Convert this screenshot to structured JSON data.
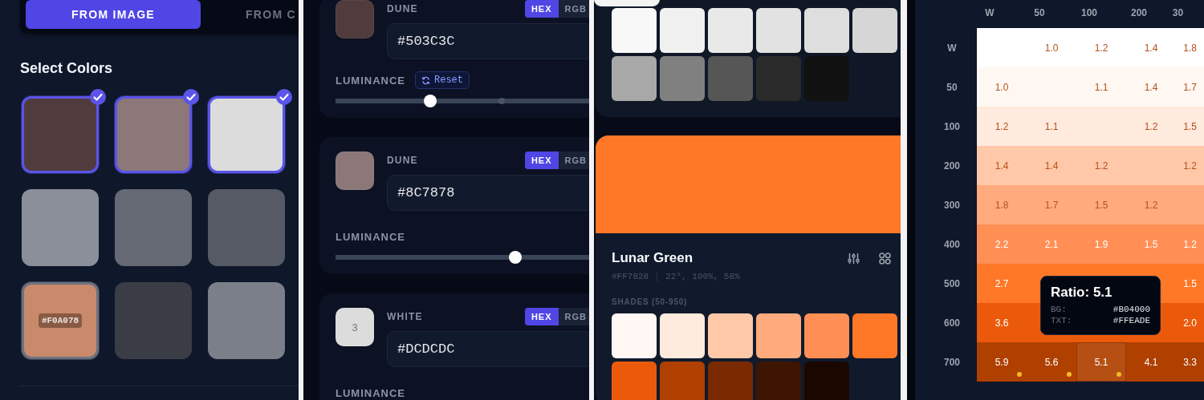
{
  "palette_picker": {
    "tabs": [
      {
        "label": "FROM IMAGE",
        "selected": true
      },
      {
        "label": "FROM C",
        "selected": false
      }
    ],
    "heading": "Select Colors",
    "swatches": [
      {
        "color": "#503c3c",
        "selected": true,
        "hovered": false
      },
      {
        "color": "#8c7878",
        "selected": true,
        "hovered": false
      },
      {
        "color": "#dcdcdc",
        "selected": true,
        "hovered": false
      },
      {
        "color": "#8a8f99",
        "selected": false,
        "hovered": false
      },
      {
        "color": "#646973",
        "selected": false,
        "hovered": false
      },
      {
        "color": "#555a64",
        "selected": false,
        "hovered": false
      },
      {
        "color": "#c98a6b",
        "selected": false,
        "hovered": true,
        "label": "#F0A078"
      },
      {
        "color": "#3a3d46",
        "selected": false,
        "hovered": false
      },
      {
        "color": "#7b7f89",
        "selected": false,
        "hovered": false
      }
    ]
  },
  "color_editors": [
    {
      "name": "DUNE",
      "color": "#503c3c",
      "formats": [
        {
          "label": "HEX",
          "selected": true
        },
        {
          "label": "RGB",
          "selected": false
        }
      ],
      "value": "#503C3C",
      "luminance": {
        "label": "LUMINANCE",
        "reset": "Reset",
        "level": 0.31,
        "original": {
          "level": 0.545
        }
      }
    },
    {
      "name": "DUNE",
      "color": "#8c7878",
      "formats": [
        {
          "label": "HEX",
          "selected": true
        },
        {
          "label": "RGB",
          "selected": false
        }
      ],
      "value": "#8C7878",
      "luminance": {
        "label": "LUMINANCE",
        "level": 0.59
      }
    },
    {
      "name": "WHITE",
      "color": "#dcdcdc",
      "swatch_label": "3",
      "formats": [
        {
          "label": "HEX",
          "selected": true
        },
        {
          "label": "RGB",
          "selected": false
        }
      ],
      "value": "#DCDCDC",
      "luminance": {
        "label": "LUMINANCE"
      }
    }
  ],
  "palette_preview": {
    "neutral_shades": [
      {
        "color": "#f8f8f8"
      },
      {
        "color": "#f0f0f0"
      },
      {
        "color": "#e9e9e9"
      },
      {
        "color": "#e2e2e2"
      },
      {
        "color": "#dedede"
      },
      {
        "color": "#d6d6d6"
      },
      {
        "color": "#a8a8a8"
      },
      {
        "color": "#808080"
      },
      {
        "color": "#565656"
      },
      {
        "color": "#2a2a2a"
      },
      {
        "color": "#111111"
      }
    ],
    "palette": {
      "color": "#ff7828",
      "name": "Lunar Green",
      "hex": "#FF7828",
      "hsl": "22°, 100%, 58%",
      "shades_label": "SHADES (50-950)",
      "shades": [
        {
          "color": "#fff8f4"
        },
        {
          "color": "#ffeade"
        },
        {
          "color": "#ffc9a8"
        },
        {
          "color": "#ffab7e"
        },
        {
          "color": "#ff8f55"
        },
        {
          "color": "#ff7828"
        },
        {
          "color": "#eb5a0a"
        },
        {
          "color": "#b04000"
        },
        {
          "color": "#7a2a00"
        },
        {
          "color": "#3d1500"
        },
        {
          "color": "#1a0800"
        }
      ]
    }
  },
  "contrast_grid": {
    "columns": [
      "W",
      "50",
      "100",
      "200",
      "30"
    ],
    "rows": [
      {
        "label": "W",
        "color": "#ffffff",
        "cells": [
          {},
          {
            "value": "1.0"
          },
          {
            "value": "1.2"
          },
          {
            "value": "1.4"
          },
          {
            "value": "1.8"
          }
        ]
      },
      {
        "label": "50",
        "color": "#fff7f2",
        "cells": [
          {
            "value": "1.0"
          },
          {},
          {
            "value": "1.1"
          },
          {
            "value": "1.4"
          },
          {
            "value": "1.7"
          }
        ]
      },
      {
        "label": "100",
        "color": "#ffeade",
        "cells": [
          {
            "value": "1.2"
          },
          {
            "value": "1.1"
          },
          {},
          {
            "value": "1.2"
          },
          {
            "value": "1.5"
          }
        ]
      },
      {
        "label": "200",
        "color": "#ffc8a8",
        "cells": [
          {
            "value": "1.4"
          },
          {
            "value": "1.4"
          },
          {
            "value": "1.2"
          },
          {},
          {
            "value": "1.2"
          }
        ]
      },
      {
        "label": "300",
        "color": "#ffab7e",
        "cells": [
          {
            "value": "1.8"
          },
          {
            "value": "1.7"
          },
          {
            "value": "1.5"
          },
          {
            "value": "1.2"
          },
          {}
        ]
      },
      {
        "label": "400",
        "color": "#ff8f55",
        "cells": [
          {
            "value": "2.2"
          },
          {
            "value": "2.1"
          },
          {
            "value": "1.9"
          },
          {
            "value": "1.5"
          },
          {
            "value": "1.2"
          }
        ]
      },
      {
        "label": "500",
        "color": "#ff7828",
        "cells": [
          {
            "value": "2.7"
          },
          {},
          {},
          {},
          {
            "value": "1.5"
          }
        ]
      },
      {
        "label": "600",
        "color": "#eb5a0a",
        "cells": [
          {
            "value": "3.6"
          },
          {},
          {},
          {},
          {
            "value": "2.0"
          }
        ]
      },
      {
        "label": "700",
        "color": "#b04000",
        "cells": [
          {
            "value": "5.9",
            "dot": true,
            "selected": false
          },
          {
            "value": "5.6",
            "dot": true,
            "selected": false
          },
          {
            "value": "5.1",
            "dot": true,
            "selected": true
          },
          {
            "value": "4.1",
            "dot": false,
            "selected": false
          },
          {
            "value": "3.3",
            "dot": false,
            "selected": false
          }
        ]
      }
    ],
    "tooltip": {
      "title": "Ratio: 5.1",
      "lines": [
        {
          "key": "BG:",
          "value": "#B04000"
        },
        {
          "key": "TXT:",
          "value": "#FFEADE"
        }
      ]
    }
  }
}
